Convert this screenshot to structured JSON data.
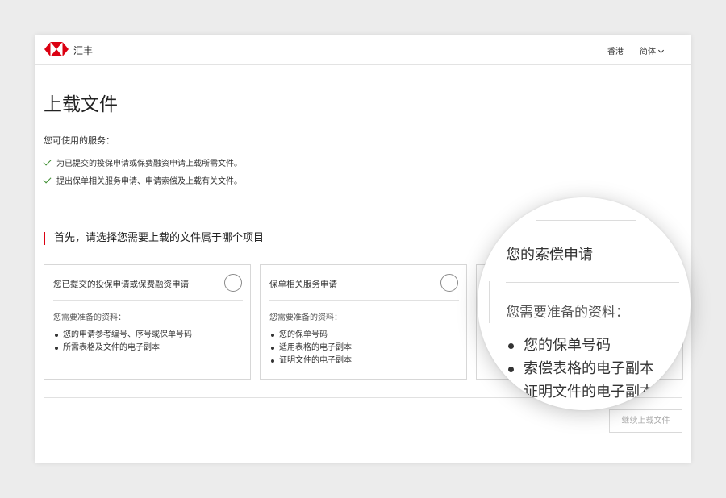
{
  "header": {
    "brand": "汇丰",
    "region": "香港",
    "language": "简体"
  },
  "page": {
    "title": "上载文件",
    "services_heading": "您可使用的服务：",
    "services": [
      "为已提交的投保申请或保费融资申请上载所需文件。",
      "提出保单相关服务申请、申请索偿及上载有关文件。"
    ],
    "section_title": "首先，请选择您需要上载的文件属于哪个项目"
  },
  "cards": [
    {
      "title": "您已提交的投保申请或保费融资申请",
      "req_label": "您需要准备的资料：",
      "items": [
        "您的申请参考编号、序号或保单号码",
        "所需表格及文件的电子副本"
      ]
    },
    {
      "title": "保单相关服务申请",
      "req_label": "您需要准备的资料：",
      "items": [
        "您的保单号码",
        "适用表格的电子副本",
        "证明文件的电子副本"
      ]
    },
    {
      "title": "您的索偿申请",
      "req_label": "您需要准备的资料：",
      "items": [
        "您的保单号码",
        "索偿表格的电子副本",
        "证明文件的电子副本"
      ]
    }
  ],
  "actions": {
    "continue_label": "继续上载文件"
  },
  "colors": {
    "brand_red": "#db0011",
    "check_green": "#3c8d2f",
    "disabled_text": "#a9a9a9"
  },
  "icons": {
    "logo": "hsbc-hexagon-logo",
    "check": "check-icon",
    "chevron": "chevron-down-icon"
  }
}
